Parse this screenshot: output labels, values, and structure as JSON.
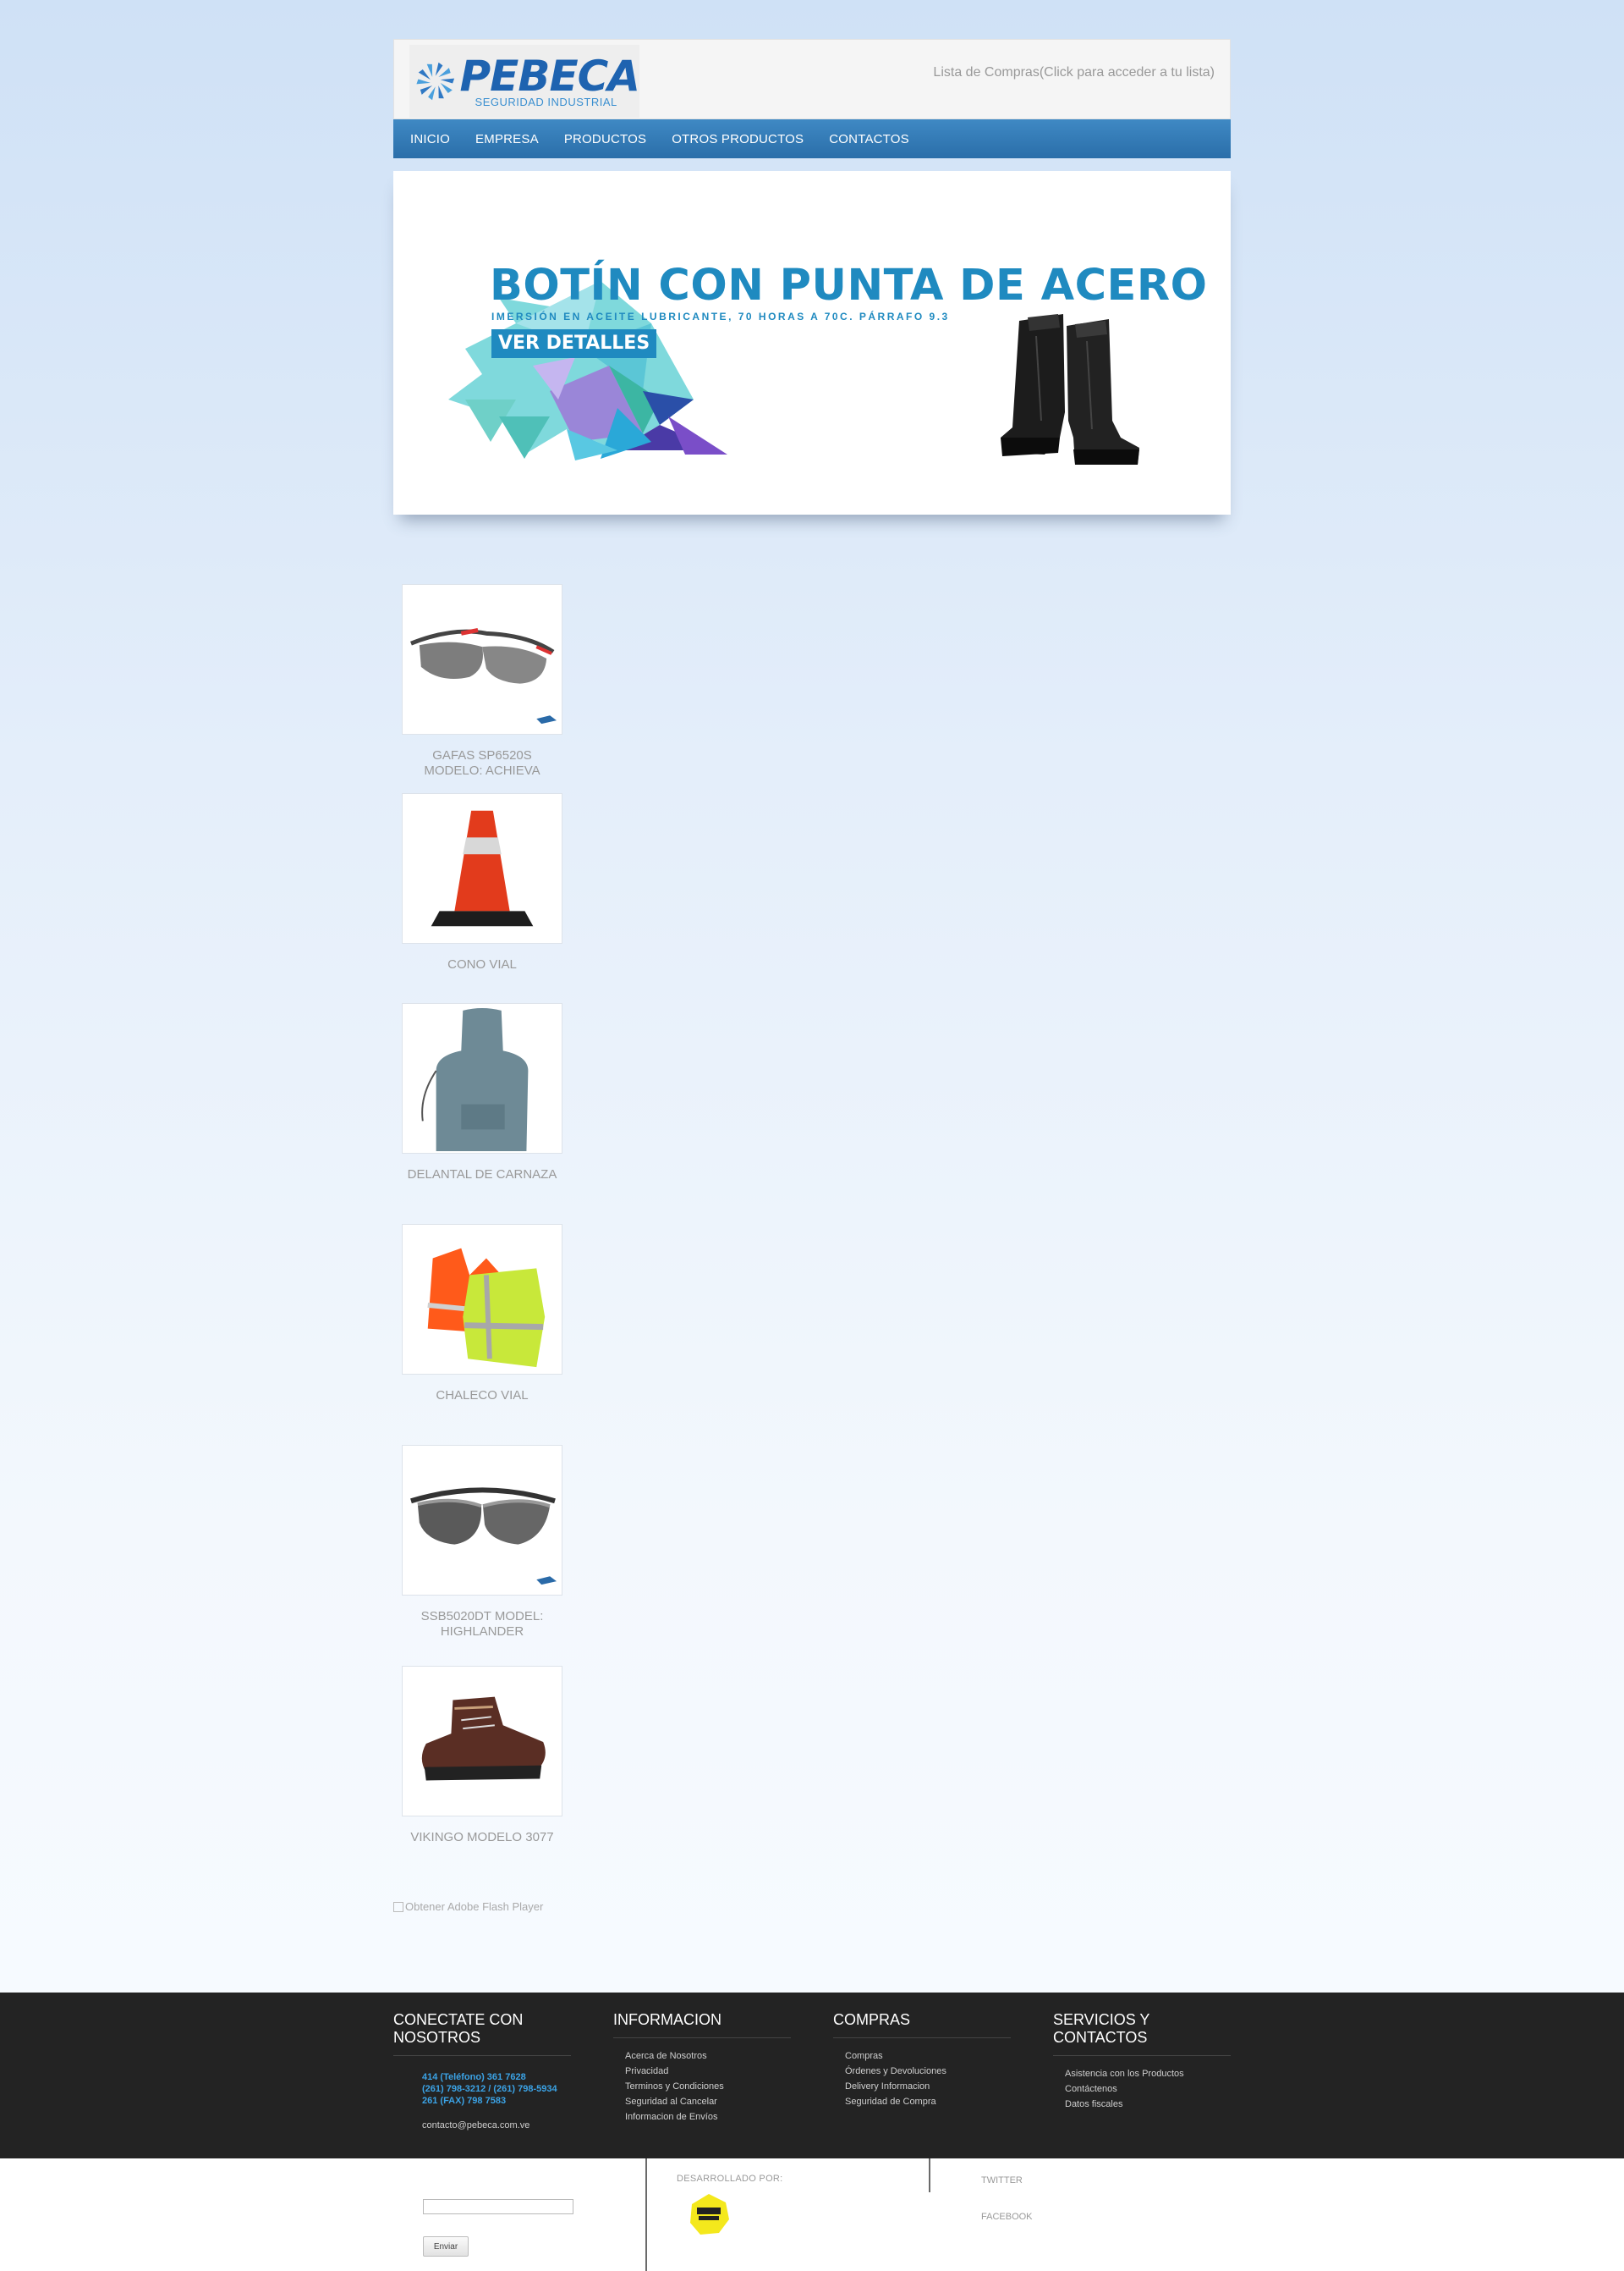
{
  "header": {
    "logo_name": "PEBECA",
    "logo_tagline": "SEGURIDAD INDUSTRIAL",
    "cart_link": "Lista de Compras(Click para acceder a tu lista)"
  },
  "nav": {
    "items": [
      {
        "label": "INICIO"
      },
      {
        "label": "EMPRESA"
      },
      {
        "label": "PRODUCTOS"
      },
      {
        "label": "OTROS PRODUCTOS"
      },
      {
        "label": "CONTACTOS"
      }
    ]
  },
  "banner": {
    "title": "BOTÍN CON PUNTA DE ACERO",
    "subtitle": "IMERSIÓN EN ACEITE LUBRICANTE, 70 HORAS A 70C. PÁRRAFO 9.3",
    "button": "VER DETALLES"
  },
  "products": [
    {
      "name": "GAFAS SP6520S MODELO: ACHIEVA",
      "icon": "safety-glasses-icon"
    },
    {
      "name": "CONO VIAL",
      "icon": "traffic-cone-icon"
    },
    {
      "name": "DELANTAL DE CARNAZA",
      "icon": "leather-apron-icon"
    },
    {
      "name": "CHALECO VIAL",
      "icon": "safety-vest-icon"
    },
    {
      "name": "SSB5020DT MODEL: HIGHLANDER",
      "icon": "sport-goggles-icon"
    },
    {
      "name": "VIKINGO MODELO 3077",
      "icon": "safety-shoe-icon"
    }
  ],
  "flash_link": "Obtener Adobe Flash Player",
  "footer": {
    "connect": {
      "title": "CONECTATE CON NOSOTROS",
      "phones": [
        "414 (Teléfono) 361 7628",
        "(261) 798-3212 / (261) 798-5934",
        "261 (FAX) 798 7583"
      ],
      "email": "contacto@pebeca.com.ve"
    },
    "informacion": {
      "title": "INFORMACION",
      "links": [
        "Acerca de Nosotros",
        "Privacidad",
        "Terminos y Condiciones",
        "Seguridad al Cancelar",
        "Informacion de Envíos"
      ]
    },
    "compras": {
      "title": "COMPRAS",
      "links": [
        "Compras",
        "Órdenes y Devoluciones",
        "Delivery Informacion",
        "Seguridad de Compra"
      ]
    },
    "servicios": {
      "title": "SERVICIOS Y CONTACTOS",
      "links": [
        "Asistencia con los Productos",
        "Contáctenos",
        "Datos fiscales"
      ]
    }
  },
  "bottom": {
    "send_button": "Enviar",
    "developed_by": "DESARROLLADO POR:",
    "twitter": "TWITTER",
    "facebook": "FACEBOOK"
  },
  "colors": {
    "brand_blue": "#1f8ac0",
    "nav_blue": "#2a6ea9",
    "footer_bg": "#232323",
    "phone_blue": "#3ba3e6"
  }
}
